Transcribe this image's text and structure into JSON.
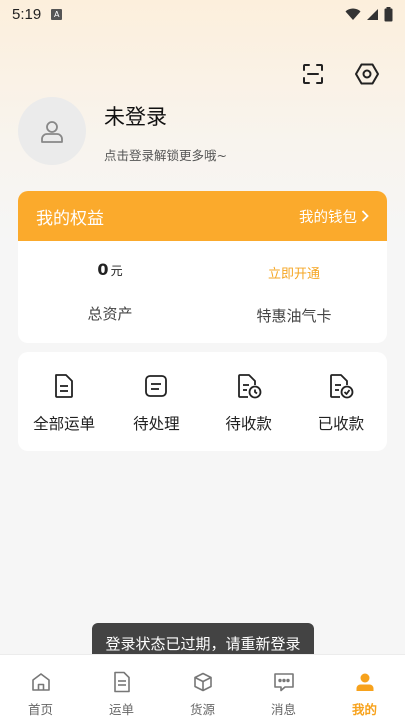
{
  "status_bar": {
    "time": "5:19",
    "a_badge": "A"
  },
  "header": {
    "scan_icon": "scan-icon",
    "settings_icon": "hex-settings-icon"
  },
  "profile": {
    "name": "未登录",
    "hint": "点击登录解锁更多哦~"
  },
  "benefits": {
    "title": "我的权益",
    "wallet_label": "我的钱包",
    "amount": "0",
    "amount_unit": "元",
    "assets_label": "总资产",
    "open_label": "立即开通",
    "oil_card_label": "特惠油气卡"
  },
  "orders": [
    {
      "label": "全部运单",
      "icon": "document-icon"
    },
    {
      "label": "待处理",
      "icon": "pending-icon"
    },
    {
      "label": "待收款",
      "icon": "receive-clock-icon"
    },
    {
      "label": "已收款",
      "icon": "received-check-icon"
    }
  ],
  "toast": {
    "message": "登录状态已过期，请重新登录"
  },
  "nav": [
    {
      "label": "首页",
      "icon": "home-icon",
      "active": false
    },
    {
      "label": "运单",
      "icon": "waybill-icon",
      "active": false
    },
    {
      "label": "货源",
      "icon": "cube-icon",
      "active": false
    },
    {
      "label": "消息",
      "icon": "message-icon",
      "active": false
    },
    {
      "label": "我的",
      "icon": "person-icon",
      "active": true
    }
  ],
  "colors": {
    "accent": "#fbaa2c",
    "active_nav": "#f7a21c",
    "open_text": "#f5a623"
  }
}
